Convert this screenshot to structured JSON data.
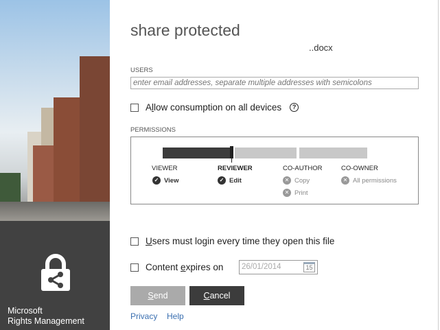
{
  "brand": {
    "line1": "Microsoft",
    "line2": "Rights Management"
  },
  "title": "share protected",
  "file_name": "..docx",
  "users": {
    "label": "USERS",
    "placeholder": "enter email addresses, separate multiple addresses with semicolons"
  },
  "allow_devices": {
    "pre": "A",
    "key": "l",
    "post": "low consumption on all devices",
    "checked": false,
    "help": "?"
  },
  "permissions": {
    "label": "PERMISSIONS",
    "selected_level": "REVIEWER",
    "levels": [
      {
        "name": "VIEWER",
        "items": [
          {
            "text": "View",
            "allowed": true
          }
        ]
      },
      {
        "name": "REVIEWER",
        "items": [
          {
            "text": "Edit",
            "allowed": true
          }
        ]
      },
      {
        "name": "CO-AUTHOR",
        "items": [
          {
            "text": "Copy",
            "allowed": false
          },
          {
            "text": "Print",
            "allowed": false
          }
        ]
      },
      {
        "name": "CO-OWNER",
        "items": [
          {
            "text": "All permissions",
            "allowed": false
          }
        ]
      }
    ]
  },
  "login_every_time": {
    "key": "U",
    "post": "sers must login every time they open this file",
    "checked": false
  },
  "expires": {
    "pre": "Content ",
    "key": "e",
    "post": "xpires on",
    "checked": false,
    "date": "26/01/2014",
    "calendar_day": "15"
  },
  "buttons": {
    "send_key": "S",
    "send_rest": "end",
    "cancel_key": "C",
    "cancel_rest": "ancel"
  },
  "links": {
    "privacy": "Privacy",
    "help": "Help"
  },
  "colors": {
    "dark": "#414141",
    "link": "#3a6fb0",
    "bar_active": "#3c3c3c",
    "bar_inactive": "#c8c8c8"
  }
}
